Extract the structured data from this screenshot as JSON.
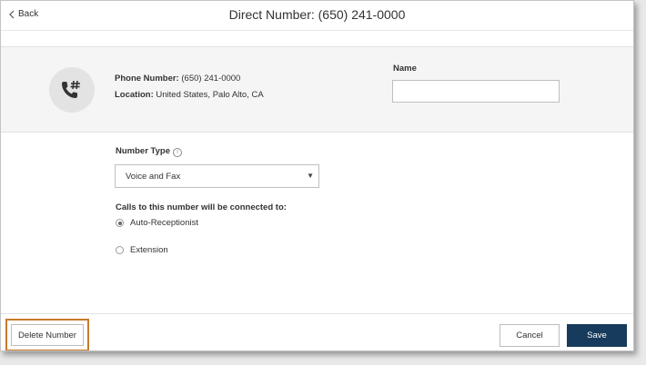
{
  "header": {
    "back_label": "Back",
    "title": "Direct Number: (650) 241-0000"
  },
  "number_info": {
    "phone_label": "Phone Number:",
    "phone_value": "(650) 241-0000",
    "location_label": "Location:",
    "location_value": "United States, Palo Alto, CA",
    "icon": "phone-hash-icon"
  },
  "name_field": {
    "label": "Name",
    "value": ""
  },
  "number_type": {
    "label": "Number Type",
    "selected": "Voice and Fax"
  },
  "routing": {
    "label": "Calls to this number will be connected to:",
    "options": [
      {
        "label": "Auto-Receptionist",
        "selected": true
      },
      {
        "label": "Extension",
        "selected": false
      }
    ]
  },
  "footer": {
    "delete_label": "Delete Number",
    "cancel_label": "Cancel",
    "save_label": "Save"
  },
  "colors": {
    "save_button": "#173b5c",
    "highlight_outline": "#c87a2a"
  }
}
